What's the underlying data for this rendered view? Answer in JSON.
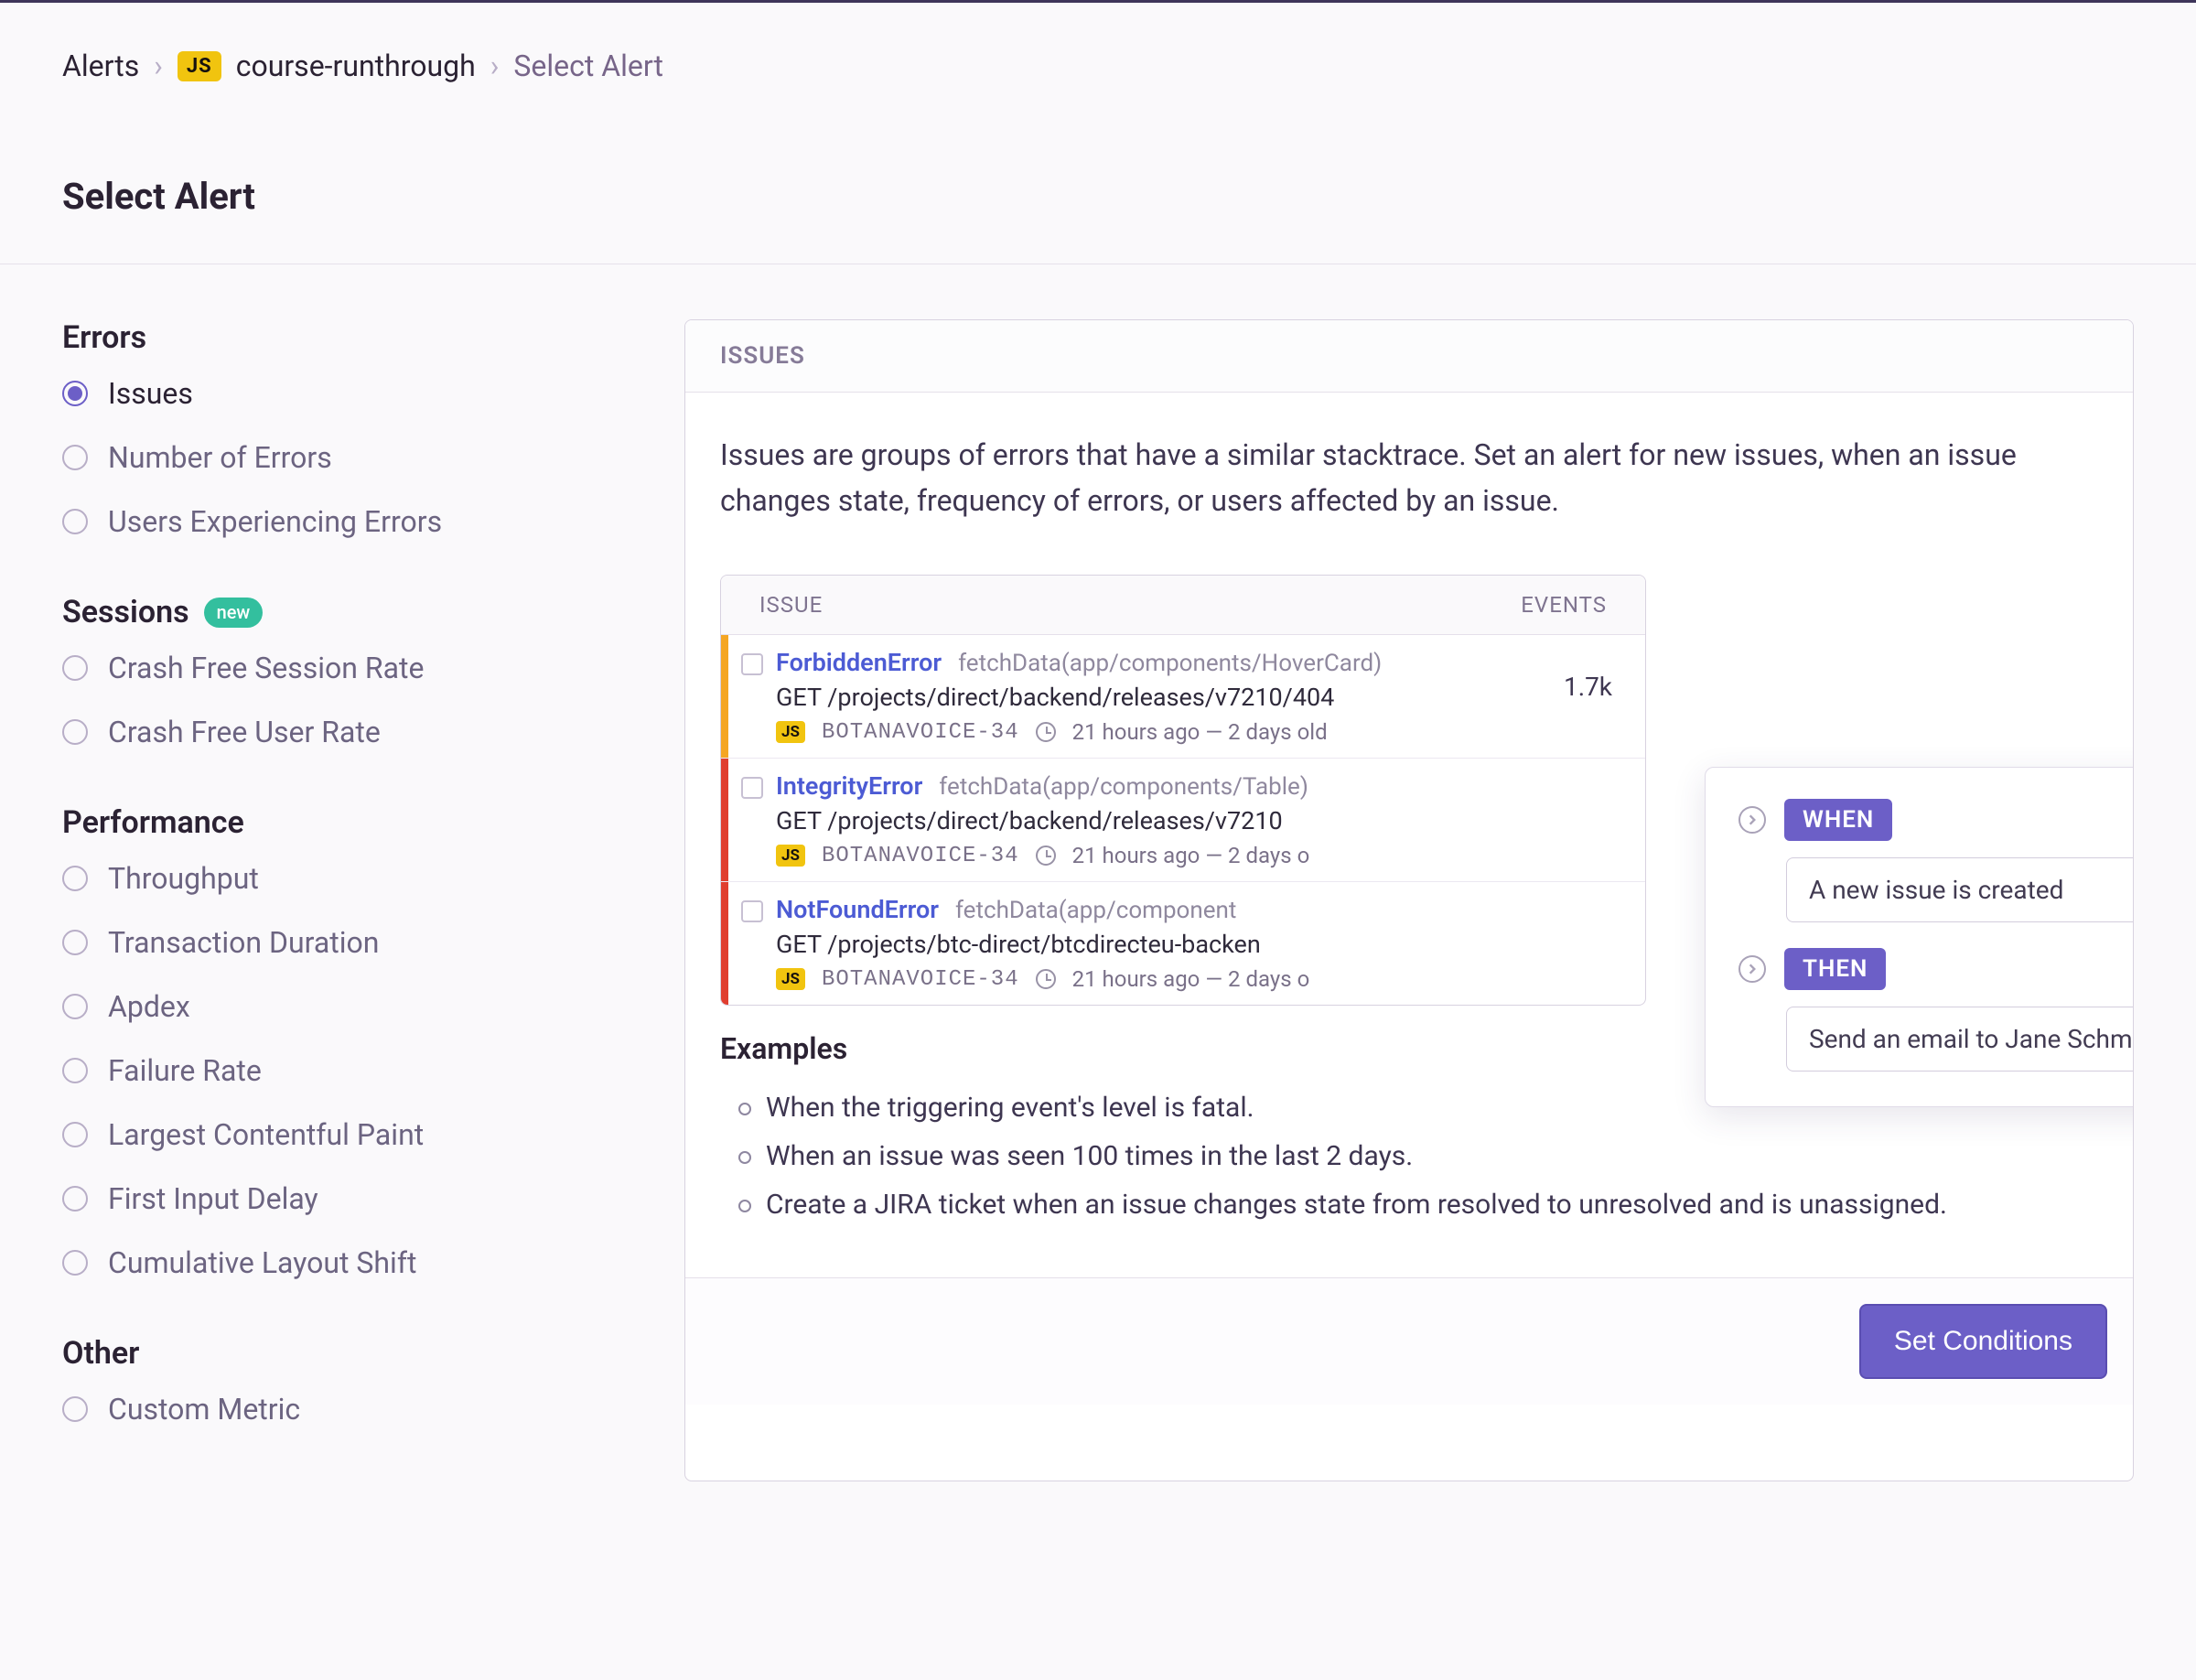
{
  "breadcrumb": {
    "root": "Alerts",
    "project_badge": "JS",
    "project": "course-runthrough",
    "current": "Select Alert"
  },
  "page_title": "Select Alert",
  "sidebar": {
    "groups": [
      {
        "heading": "Errors",
        "badge": null,
        "items": [
          {
            "label": "Issues",
            "selected": true
          },
          {
            "label": "Number of Errors",
            "selected": false
          },
          {
            "label": "Users Experiencing Errors",
            "selected": false
          }
        ]
      },
      {
        "heading": "Sessions",
        "badge": "new",
        "items": [
          {
            "label": "Crash Free Session Rate",
            "selected": false
          },
          {
            "label": "Crash Free User Rate",
            "selected": false
          }
        ]
      },
      {
        "heading": "Performance",
        "badge": null,
        "items": [
          {
            "label": "Throughput",
            "selected": false
          },
          {
            "label": "Transaction Duration",
            "selected": false
          },
          {
            "label": "Apdex",
            "selected": false
          },
          {
            "label": "Failure Rate",
            "selected": false
          },
          {
            "label": "Largest Contentful Paint",
            "selected": false
          },
          {
            "label": "First Input Delay",
            "selected": false
          },
          {
            "label": "Cumulative Layout Shift",
            "selected": false
          }
        ]
      },
      {
        "heading": "Other",
        "badge": null,
        "items": [
          {
            "label": "Custom Metric",
            "selected": false
          }
        ]
      }
    ]
  },
  "panel": {
    "header": "ISSUES",
    "description": "Issues are groups of errors that have a similar stacktrace. Set an alert for new issues, when an issue changes state, frequency of errors, or users affected by an issue.",
    "table": {
      "col_issue": "ISSUE",
      "col_events": "EVENTS",
      "rows": [
        {
          "severity": "orange",
          "title": "ForbiddenError",
          "func": "fetchData(app/components/HoverCard)",
          "path": "GET /projects/direct/backend/releases/v7210/404",
          "project_badge": "JS",
          "issue_id": "BOTANAVOICE-34",
          "time": "21 hours ago — 2 days old",
          "events": "1.7k"
        },
        {
          "severity": "red",
          "title": "IntegrityError",
          "func": "fetchData(app/components/Table)",
          "path": "GET /projects/direct/backend/releases/v7210",
          "project_badge": "JS",
          "issue_id": "BOTANAVOICE-34",
          "time": "21 hours ago — 2 days o",
          "events": ""
        },
        {
          "severity": "red",
          "title": "NotFoundError",
          "func": "fetchData(app/component",
          "path": "GET /projects/btc-direct/btcdirecteu-backen",
          "project_badge": "JS",
          "issue_id": "BOTANAVOICE-34",
          "time": "21 hours ago — 2 days o",
          "events": ""
        }
      ]
    },
    "rule": {
      "when_label": "WHEN",
      "when_value": "A new issue is created",
      "then_label": "THEN",
      "then_value": "Send an email to Jane Schmidt"
    },
    "examples_heading": "Examples",
    "examples": [
      "When the triggering event's level is fatal.",
      "When an issue was seen 100 times in the last 2 days.",
      "Create a JIRA ticket when an issue changes state from resolved to unresolved and is unassigned."
    ],
    "cta": "Set Conditions"
  }
}
